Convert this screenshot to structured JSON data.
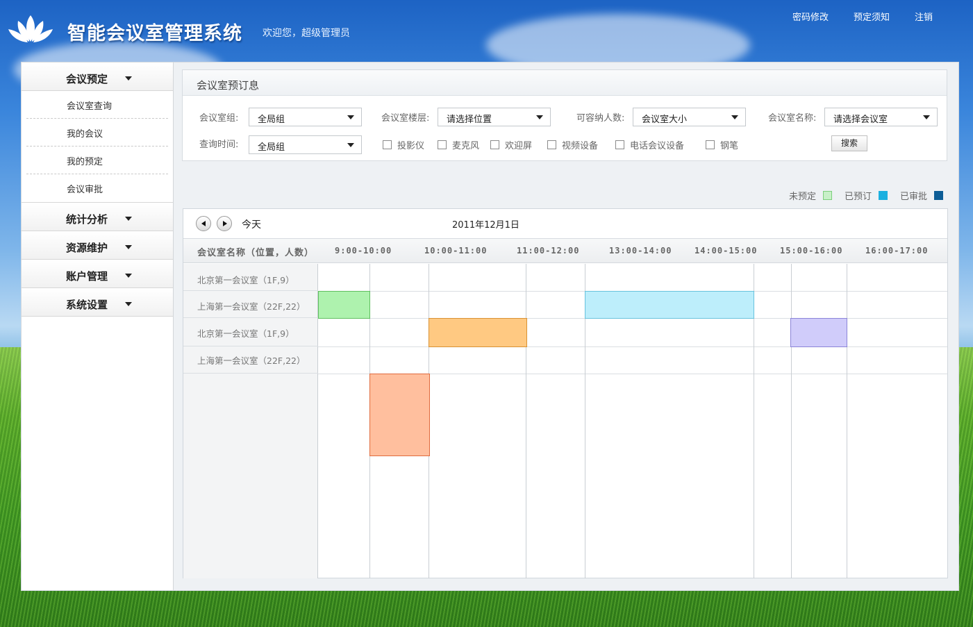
{
  "header": {
    "app_title": "智能会议室管理系统",
    "welcome": "欢迎您，超级管理员",
    "links": [
      "密码修改",
      "预定须知",
      "注销"
    ]
  },
  "sidebar": {
    "sections": [
      {
        "label": "会议预定",
        "items": [
          "会议室查询",
          "我的会议",
          "我的预定",
          "会议审批"
        ]
      },
      {
        "label": "统计分析",
        "items": []
      },
      {
        "label": "资源维护",
        "items": []
      },
      {
        "label": "账户管理",
        "items": []
      },
      {
        "label": "系统设置",
        "items": []
      }
    ]
  },
  "search": {
    "title": "会议室预订息",
    "fields": {
      "group_label": "会议室组:",
      "group_value": "全局组",
      "floor_label": "会议室楼层:",
      "floor_value": "请选择位置",
      "capacity_label": "可容纳人数:",
      "capacity_value": "会议室大小",
      "name_label": "会议室名称:",
      "name_value": "请选择会议室",
      "time_label": "查询时间:",
      "time_value": "全局组"
    },
    "equipment": [
      "投影仪",
      "麦克风",
      "欢迎屏",
      "视频设备",
      "电话会议设备",
      "钢笔"
    ],
    "search_button": "搜索"
  },
  "legend": [
    {
      "label": "未预定",
      "color": "#c8f0c8"
    },
    {
      "label": "已预订",
      "color": "#1bb0e0"
    },
    {
      "label": "已审批",
      "color": "#0d5d96"
    }
  ],
  "schedule": {
    "today_label": "今天",
    "date": "2011年12月1日",
    "room_col_header": "会议室名称（位置，人数）",
    "time_slots": [
      "9:00-10:00",
      "10:00-11:00",
      "11:00-12:00",
      "13:00-14:00",
      "14:00-15:00",
      "15:00-16:00",
      "16:00-17:00"
    ],
    "rooms": [
      "北京第一会议室（1F,9）",
      "上海第一会议室（22F,22）",
      "北京第一会议室（1F,9）",
      "上海第一会议室（22F,22）"
    ],
    "bookings": [
      {
        "color": "#aef2ae",
        "border": "#5fbf5f"
      },
      {
        "color": "#bdeefb",
        "border": "#67c2dd"
      },
      {
        "color": "#ffc982",
        "border": "#d99234"
      },
      {
        "color": "#d0ccfa",
        "border": "#8b84d8"
      },
      {
        "color": "#ffbf9e",
        "border": "#e06a3c"
      }
    ]
  }
}
